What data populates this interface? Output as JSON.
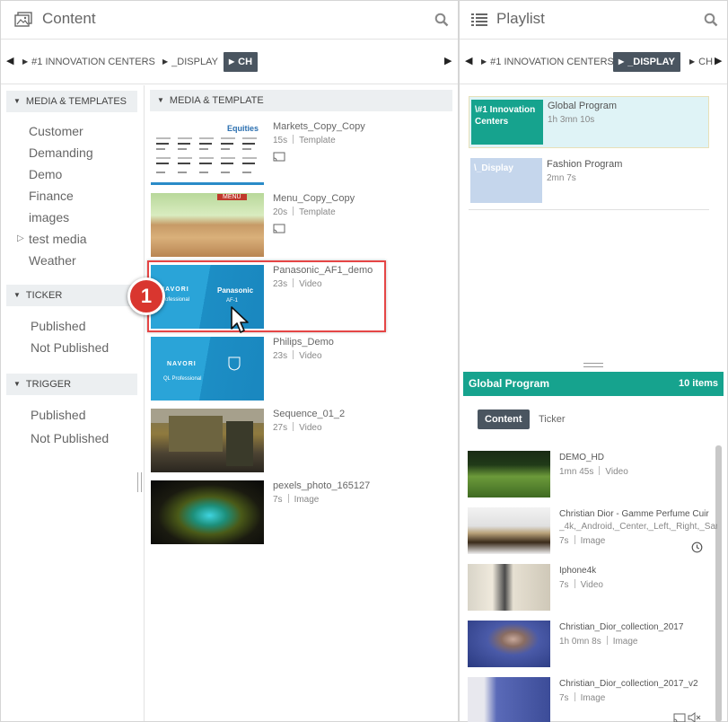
{
  "content_pane": {
    "title": "Content",
    "breadcrumbs": [
      "#1 INNOVATION CENTERS",
      "_DISPLAY",
      "CH"
    ],
    "sidebar": {
      "media_section": "MEDIA & TEMPLATES",
      "media_items": [
        "Customer",
        "Demanding",
        "Demo",
        "Finance",
        "images",
        "test media",
        "Weather"
      ],
      "ticker_section": "TICKER",
      "ticker_items": [
        "Published",
        "Not Published"
      ],
      "trigger_section": "TRIGGER",
      "trigger_items": [
        "Published",
        "Not Published"
      ]
    },
    "media_header": "MEDIA & TEMPLATE",
    "media": [
      {
        "name": "Markets_Copy_Copy",
        "duration": "15s",
        "type": "Template"
      },
      {
        "name": "Menu_Copy_Copy",
        "duration": "20s",
        "type": "Template"
      },
      {
        "name": "Panasonic_AF1_demo",
        "duration": "23s",
        "type": "Video"
      },
      {
        "name": "Philips_Demo",
        "duration": "23s",
        "type": "Video"
      },
      {
        "name": "Sequence_01_2",
        "duration": "27s",
        "type": "Video"
      },
      {
        "name": "pexels_photo_165127",
        "duration": "7s",
        "type": "Image"
      }
    ],
    "thumb_text": {
      "equities": "Equities",
      "menu": "MENU",
      "navori": "NAVORI",
      "professional": "Professional",
      "panasonic": "Panasonic",
      "af1": "AF-1",
      "ql_professional": "QL Professional"
    },
    "step_number": "1"
  },
  "playlist_pane": {
    "title": "Playlist",
    "breadcrumbs": [
      "#1 INNOVATION CENTERS",
      "_DISPLAY",
      "CH"
    ],
    "cards": [
      {
        "thumb_label": "\\#1 Innovation Centers",
        "name": "Global Program",
        "duration": "1h 3mn 10s"
      },
      {
        "thumb_label": "\\_Display",
        "name": "Fashion Program",
        "duration": "2mn 7s"
      }
    ],
    "program_bar": {
      "name": "Global Program",
      "count": "10 items"
    },
    "tabs": [
      "Content",
      "Ticker"
    ],
    "items": [
      {
        "name": "DEMO_HD",
        "sub": "",
        "duration": "1mn 45s",
        "type": "Video"
      },
      {
        "name": "Christian Dior - Gamme Perfume Cuir",
        "sub": "_4k,_Android,_Center,_Left,_Right,_San",
        "duration": "7s",
        "type": "Image"
      },
      {
        "name": "Iphone4k",
        "sub": "",
        "duration": "7s",
        "type": "Video"
      },
      {
        "name": "Christian_Dior_collection_2017",
        "sub": "",
        "duration": "1h 0mn 8s",
        "type": "Image"
      },
      {
        "name": "Christian_Dior_collection_2017_v2",
        "sub": "",
        "duration": "7s",
        "type": "Image"
      }
    ]
  },
  "colors": {
    "accent_teal": "#16a38e",
    "dark_tab": "#4a5560",
    "highlight_red": "#e54545",
    "selected_card": "#dff3f6"
  }
}
